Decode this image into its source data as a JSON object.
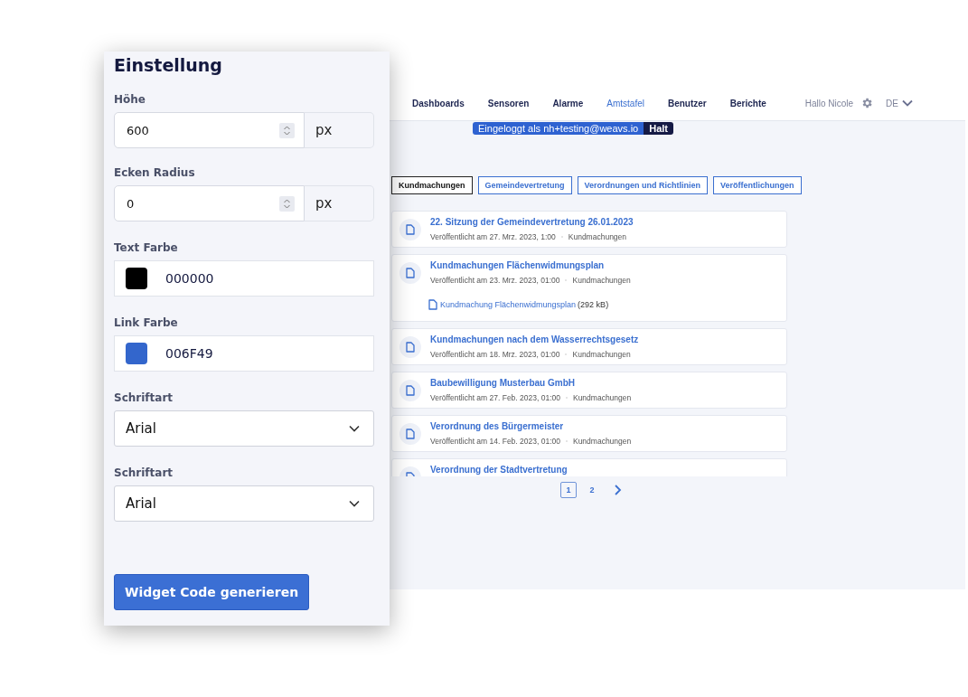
{
  "site": {
    "nav": [
      {
        "label": "Dashboards",
        "selected": false
      },
      {
        "label": "Sensoren",
        "selected": false
      },
      {
        "label": "Alarme",
        "selected": false
      },
      {
        "label": "Amtstafel",
        "selected": true
      },
      {
        "label": "Benutzer",
        "selected": false
      },
      {
        "label": "Berichte",
        "selected": false
      }
    ],
    "greeting": "Hallo Nicole",
    "language": "DE",
    "login_banner": {
      "text": "Eingeloggt als nh+testing@weavs.io",
      "action": "Halt"
    },
    "filters": [
      {
        "label": "Kundmachungen",
        "selected": true
      },
      {
        "label": "Gemeindevertretung",
        "selected": false
      },
      {
        "label": "Verordnungen und Richtlinien",
        "selected": false
      },
      {
        "label": "Veröffentlichungen",
        "selected": false
      }
    ],
    "notices": [
      {
        "title": "22. Sitzung der Gemeindevertretung 26.01.2023",
        "published": "Veröffentlicht am 27. Mrz. 2023, 1:00",
        "category": "Kundmachungen"
      },
      {
        "title": "Kundmachungen Flächenwidmungsplan",
        "published": "Veröffentlicht am 23. Mrz. 2023, 01:00",
        "category": "Kundmachungen",
        "attachment": {
          "name": "Kundmachung Flächenwidmungsplan",
          "size": "(292 kB)"
        }
      },
      {
        "title": "Kundmachungen nach dem Wasserrechtsgesetz",
        "published": "Veröffentlicht am 18. Mrz. 2023, 01:00",
        "category": "Kundmachungen"
      },
      {
        "title": "Baubewilligung Musterbau GmbH",
        "published": "Veröffentlicht am 27. Feb. 2023, 01:00",
        "category": "Kundmachungen"
      },
      {
        "title": "Verordnung des Bürgermeister",
        "published": "Veröffentlicht am 14. Feb. 2023, 01:00",
        "category": "Kundmachungen"
      },
      {
        "title": "Verordnung der Stadtvertretung"
      }
    ],
    "pagination": [
      {
        "label": "1",
        "selected": true
      },
      {
        "label": "2",
        "selected": false
      }
    ]
  },
  "panel": {
    "title": "Einstellung",
    "fields": [
      {
        "kind": "number",
        "label": "Höhe",
        "value": "600",
        "unit": "px"
      },
      {
        "kind": "number",
        "label": "Ecken Radius",
        "value": "0",
        "unit": "px"
      },
      {
        "kind": "color",
        "label": "Text Farbe",
        "value": "000000",
        "color": "#000000"
      },
      {
        "kind": "color",
        "label": "Link Farbe",
        "value": "006F49",
        "color": "#3366cc"
      },
      {
        "kind": "select",
        "label": "Schriftart",
        "value": "Arial"
      },
      {
        "kind": "select",
        "label": "Schriftart",
        "value": "Arial"
      }
    ],
    "button": "Widget Code generieren"
  }
}
